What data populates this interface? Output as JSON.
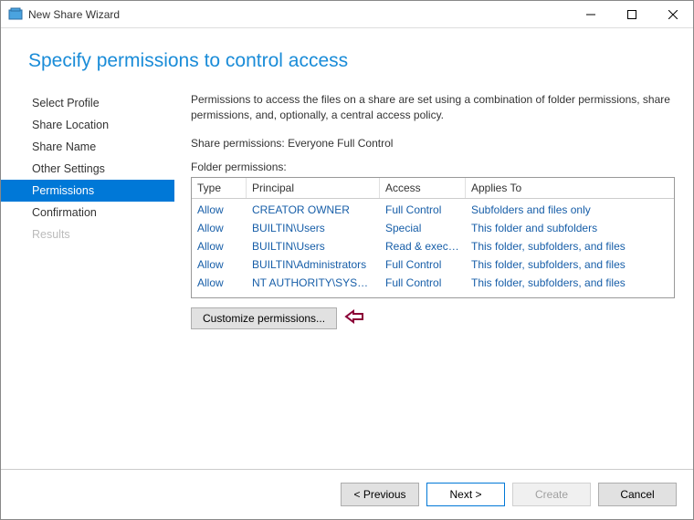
{
  "titlebar": {
    "title": "New Share Wizard"
  },
  "header": {
    "page_title": "Specify permissions to control access"
  },
  "sidebar": {
    "items": [
      {
        "label": "Select Profile",
        "state": "normal"
      },
      {
        "label": "Share Location",
        "state": "normal"
      },
      {
        "label": "Share Name",
        "state": "normal"
      },
      {
        "label": "Other Settings",
        "state": "normal"
      },
      {
        "label": "Permissions",
        "state": "active"
      },
      {
        "label": "Confirmation",
        "state": "normal"
      },
      {
        "label": "Results",
        "state": "disabled"
      }
    ]
  },
  "main": {
    "description": "Permissions to access the files on a share are set using a combination of folder permissions, share permissions, and, optionally, a central access policy.",
    "share_permissions_label": "Share permissions:",
    "share_permissions_value": "Everyone Full Control",
    "folder_permissions_label": "Folder permissions:",
    "table": {
      "headers": {
        "type": "Type",
        "principal": "Principal",
        "access": "Access",
        "applies_to": "Applies To"
      },
      "rows": [
        {
          "type": "Allow",
          "principal": "CREATOR OWNER",
          "access": "Full Control",
          "applies_to": "Subfolders and files only"
        },
        {
          "type": "Allow",
          "principal": "BUILTIN\\Users",
          "access": "Special",
          "applies_to": "This folder and subfolders"
        },
        {
          "type": "Allow",
          "principal": "BUILTIN\\Users",
          "access": "Read & execu...",
          "applies_to": "This folder, subfolders, and files"
        },
        {
          "type": "Allow",
          "principal": "BUILTIN\\Administrators",
          "access": "Full Control",
          "applies_to": "This folder, subfolders, and files"
        },
        {
          "type": "Allow",
          "principal": "NT AUTHORITY\\SYSTEM",
          "access": "Full Control",
          "applies_to": "This folder, subfolders, and files"
        }
      ]
    },
    "customize_label": "Customize permissions..."
  },
  "footer": {
    "previous": "< Previous",
    "next": "Next >",
    "create": "Create",
    "cancel": "Cancel"
  }
}
